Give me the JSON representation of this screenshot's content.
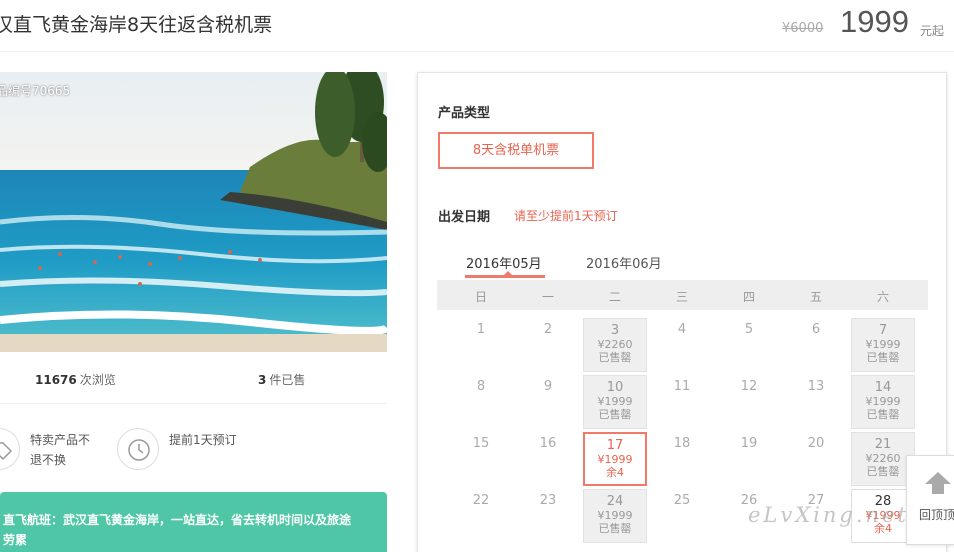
{
  "header": {
    "title": "汉直飞黄金海岸8天往返含税机票",
    "original_price": "¥6000",
    "price": "1999",
    "price_unit": "元起"
  },
  "hero": {
    "product_code": "品编号70665"
  },
  "stats": {
    "views_count": "11676",
    "views_label": "次浏览",
    "sold_count": "3",
    "sold_label": "件已售"
  },
  "features": [
    {
      "icon": "price-tag-icon",
      "text": "特卖产品不退不换"
    },
    {
      "icon": "clock-icon",
      "text": "提前1天预订"
    }
  ],
  "flight_info": {
    "line1": "直飞航班：武汉直飞黄金海岸，一站直达，省去转机时间以及旅途",
    "line2": "劳累"
  },
  "booking": {
    "product_type_label": "产品类型",
    "product_type_option": "8天含税单机票",
    "departure_label": "出发日期",
    "advance_note": "请至少提前1天预订",
    "months": [
      "2016年05月",
      "2016年06月"
    ],
    "active_month_index": 0,
    "weekdays": [
      "日",
      "一",
      "二",
      "三",
      "四",
      "五",
      "六"
    ],
    "days": [
      {
        "day": "1",
        "col": 0,
        "row": 0
      },
      {
        "day": "2",
        "col": 1,
        "row": 0
      },
      {
        "day": "3",
        "col": 2,
        "row": 0,
        "status": "sold",
        "price": "¥2260",
        "note": "已售罄"
      },
      {
        "day": "4",
        "col": 3,
        "row": 0
      },
      {
        "day": "5",
        "col": 4,
        "row": 0
      },
      {
        "day": "6",
        "col": 5,
        "row": 0
      },
      {
        "day": "7",
        "col": 6,
        "row": 0,
        "status": "sold",
        "price": "¥1999",
        "note": "已售罄"
      },
      {
        "day": "8",
        "col": 0,
        "row": 1
      },
      {
        "day": "9",
        "col": 1,
        "row": 1
      },
      {
        "day": "10",
        "col": 2,
        "row": 1,
        "status": "sold",
        "price": "¥1999",
        "note": "已售罄"
      },
      {
        "day": "11",
        "col": 3,
        "row": 1
      },
      {
        "day": "12",
        "col": 4,
        "row": 1
      },
      {
        "day": "13",
        "col": 5,
        "row": 1
      },
      {
        "day": "14",
        "col": 6,
        "row": 1,
        "status": "sold",
        "price": "¥1999",
        "note": "已售罄"
      },
      {
        "day": "15",
        "col": 0,
        "row": 2
      },
      {
        "day": "16",
        "col": 1,
        "row": 2
      },
      {
        "day": "17",
        "col": 2,
        "row": 2,
        "status": "selected",
        "price": "¥1999",
        "note": "余4"
      },
      {
        "day": "18",
        "col": 3,
        "row": 2
      },
      {
        "day": "19",
        "col": 4,
        "row": 2
      },
      {
        "day": "20",
        "col": 5,
        "row": 2
      },
      {
        "day": "21",
        "col": 6,
        "row": 2,
        "status": "sold",
        "price": "¥2260",
        "note": "已售罄"
      },
      {
        "day": "22",
        "col": 0,
        "row": 3
      },
      {
        "day": "23",
        "col": 1,
        "row": 3
      },
      {
        "day": "24",
        "col": 2,
        "row": 3,
        "status": "sold",
        "price": "¥1999",
        "note": "已售罄"
      },
      {
        "day": "25",
        "col": 3,
        "row": 3
      },
      {
        "day": "26",
        "col": 4,
        "row": 3
      },
      {
        "day": "27",
        "col": 5,
        "row": 3
      },
      {
        "day": "28",
        "col": 6,
        "row": 3,
        "status": "avail",
        "price": "¥1999",
        "note": "余4"
      }
    ]
  },
  "watermark": "eLvXing.net",
  "back_top_label": "回顶顶",
  "colors": {
    "accent": "#f07a6a",
    "flight_box": "#4fc7a7"
  }
}
